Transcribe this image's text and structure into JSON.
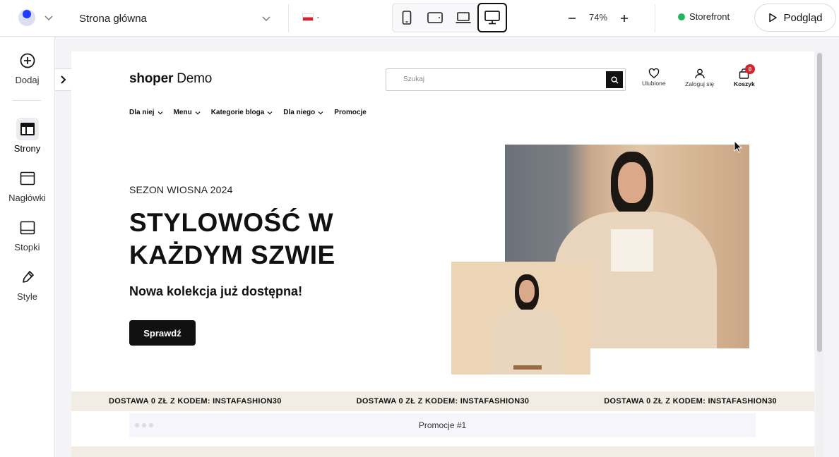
{
  "topbar": {
    "page_select": "Strona główna",
    "zoom_value": "74%",
    "status_label": "Storefront",
    "preview_label": "Podgląd",
    "devices": [
      "mobile-icon",
      "tablet-icon",
      "laptop-icon",
      "desktop-icon"
    ],
    "active_device": "desktop-icon"
  },
  "sidebar": {
    "items": [
      {
        "label": "Dodaj",
        "icon": "plus-circle-icon"
      },
      {
        "label": "Strony",
        "icon": "layout-icon"
      },
      {
        "label": "Nagłówki",
        "icon": "header-icon"
      },
      {
        "label": "Stopki",
        "icon": "footer-icon"
      },
      {
        "label": "Style",
        "icon": "pen-icon"
      }
    ],
    "active": "Strony"
  },
  "store": {
    "logo_brand": "shoper",
    "logo_rest": "Demo",
    "search_placeholder": "Szukaj",
    "header_icons": [
      {
        "label": "Ulubione",
        "icon": "heart-icon"
      },
      {
        "label": "Zaloguj się",
        "icon": "user-icon"
      },
      {
        "label": "Koszyk",
        "icon": "bag-icon",
        "badge": "0"
      }
    ],
    "nav": [
      {
        "label": "Dla niej",
        "has_dropdown": true
      },
      {
        "label": "Menu",
        "has_dropdown": true
      },
      {
        "label": "Kategorie bloga",
        "has_dropdown": true
      },
      {
        "label": "Dla niego",
        "has_dropdown": true
      },
      {
        "label": "Promocje",
        "has_dropdown": false
      }
    ],
    "hero": {
      "eyebrow": "SEZON WIOSNA 2024",
      "title_line1": "STYLOWOŚĆ W",
      "title_line2": "KAŻDYM SZWIE",
      "subtitle": "Nowa kolekcja już dostępna!",
      "button": "Sprawdź"
    },
    "promo_strip": [
      "DOSTAWA 0 ZŁ Z KODEM: INSTAFASHION30",
      "DOSTAWA 0 ZŁ Z KODEM: INSTAFASHION30",
      "DOSTAWA 0 ZŁ Z KODEM: INSTAFASHION30"
    ],
    "promo_section": "Promocje #1"
  },
  "colors": {
    "accent": "#1f3bff",
    "status": "#22b55a",
    "badge": "#d6232c",
    "strip": "#f1ede4"
  }
}
